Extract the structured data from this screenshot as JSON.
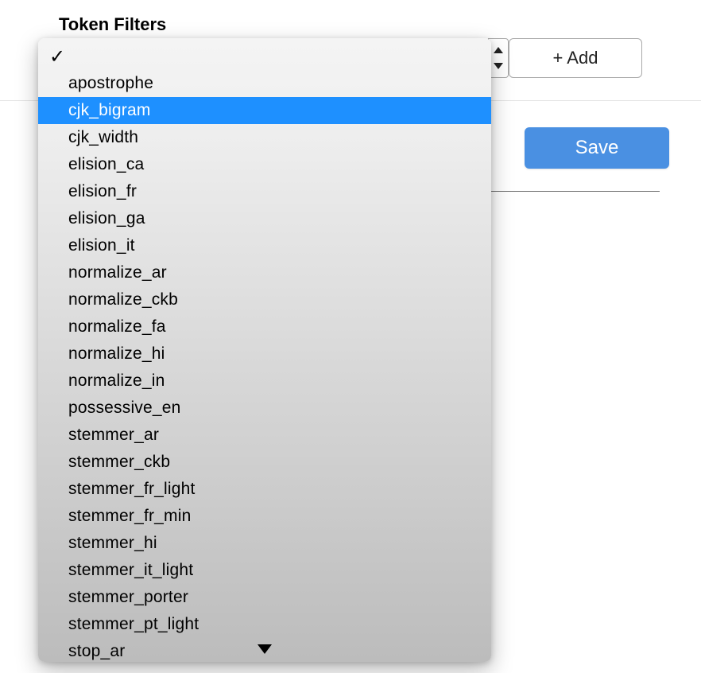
{
  "header": {
    "label": "Token Filters"
  },
  "buttons": {
    "add_label": "+ Add",
    "save_label": "Save"
  },
  "dropdown": {
    "selected_value": "",
    "highlighted_value": "cjk_bigram",
    "options": [
      "apostrophe",
      "cjk_bigram",
      "cjk_width",
      "elision_ca",
      "elision_fr",
      "elision_ga",
      "elision_it",
      "normalize_ar",
      "normalize_ckb",
      "normalize_fa",
      "normalize_hi",
      "normalize_in",
      "possessive_en",
      "stemmer_ar",
      "stemmer_ckb",
      "stemmer_fr_light",
      "stemmer_fr_min",
      "stemmer_hi",
      "stemmer_it_light",
      "stemmer_porter",
      "stemmer_pt_light",
      "stop_ar"
    ]
  }
}
